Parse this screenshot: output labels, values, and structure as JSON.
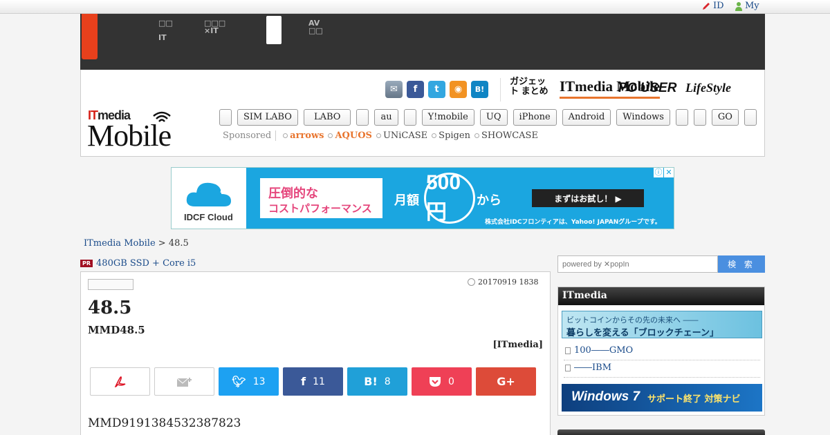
{
  "util": {
    "id_label": "ID",
    "my_label": "My"
  },
  "darknav": {
    "item1_l1": "□□",
    "item1_l2": "IT",
    "item2_l1": "□□□",
    "item2_l2": "×IT",
    "item3_l1": "AV",
    "item3_l2": "□□"
  },
  "logo": {
    "it": "IT",
    "media": "media",
    "mobile": "Mobile"
  },
  "social": {
    "mail": "✉",
    "facebook": "f",
    "twitter": "t",
    "rss": "◉",
    "hatena": "B!"
  },
  "brands": [
    "ガジェット まとめ",
    "ITmedia Mobile",
    "PC USER",
    "LifeStyle"
  ],
  "nav": [
    "",
    "SIM LABO",
    "LABO",
    "",
    "au",
    "",
    "Y!mobile",
    "UQ",
    "iPhone",
    "Android",
    "Windows",
    "",
    "",
    "GO",
    ""
  ],
  "sponsored": {
    "label": "Sponsored",
    "items": [
      "arrows",
      "AQUOS",
      "UNiCASE",
      "Spigen",
      "SHOWCASE"
    ]
  },
  "ad": {
    "brand": "IDCF Cloud",
    "line1": "圧倒的な",
    "line2": "コストパフォーマンス",
    "monthly": "月額",
    "price": "500円",
    "from": "から",
    "cta": "まずはお試し！ ▶",
    "footer": "株式会社IDCフロンティアは、Yahoo! JAPANグループです。"
  },
  "breadcrumb": {
    "root": "ITmedia Mobile",
    "sep": " > ",
    "current": "48.5"
  },
  "pr": {
    "tag": "PR",
    "text": "480GB SSD + Core i5"
  },
  "article": {
    "date": "20170919 1838",
    "title": "48.5",
    "subtitle": "MMD48.5",
    "credit": "[ITmedia]",
    "shares": {
      "twitter": "13",
      "facebook": "11",
      "hatena": "8",
      "pocket": "0"
    },
    "body": "MMD9191384532387823"
  },
  "search": {
    "placeholder": "powered by ✕popIn",
    "button": "検 索"
  },
  "sidebar": {
    "title": "ITmedia",
    "banner1_l1": "ビットコインからその先の未来へ ――",
    "banner1_l2": "暮らしを変える「ブロックチェーン」",
    "links": [
      "100――GMO",
      "――IBM"
    ],
    "banner2_a": "Windows 7",
    "banner2_b": "サポート終了 対策ナビ"
  }
}
